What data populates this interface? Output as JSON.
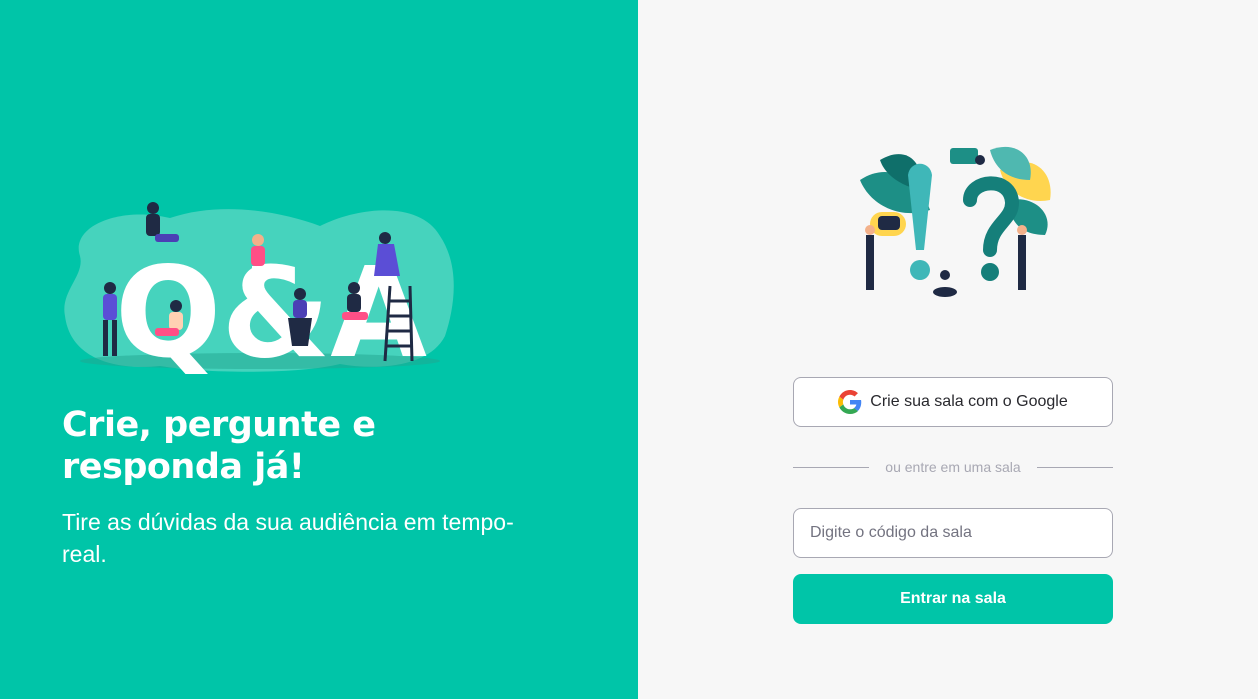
{
  "aside": {
    "headline": "Crie, pergunte e responda já!",
    "subtext": "Tire as dúvidas da sua audiência em tempo-real.",
    "illustration_text": "Q&A"
  },
  "main": {
    "google_button_label": "Crie sua sala com o Google",
    "separator_text": "ou entre em uma sala",
    "room_code_placeholder": "Digite o código da sala",
    "room_code_value": "",
    "enter_button_label": "Entrar na sala"
  },
  "colors": {
    "brand": "#00c5a8",
    "background": "#f7f7f7",
    "border": "#a8a8b3",
    "text_dark": "#29292e"
  },
  "icons": [
    "google-icon"
  ]
}
